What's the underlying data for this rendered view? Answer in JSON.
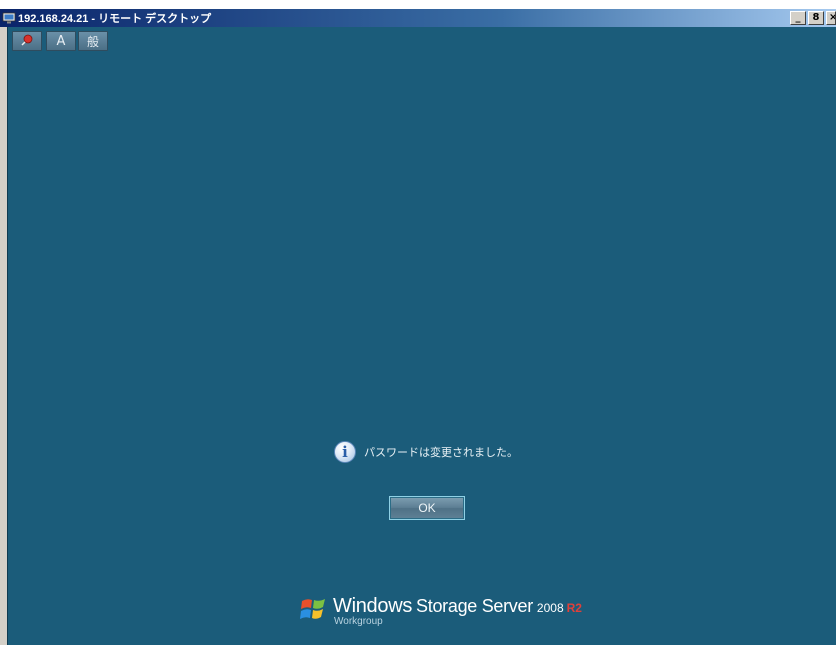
{
  "window": {
    "title": "192.168.24.21 - リモート デスクトップ",
    "controls": {
      "minimize": "_",
      "restore": "8",
      "close": "×"
    }
  },
  "toolbar": {
    "buttons": [
      {
        "icon": "pin-icon",
        "glyph": ""
      },
      {
        "icon": "input-mode-icon",
        "glyph": "A"
      },
      {
        "icon": "ime-mode-icon",
        "glyph": "般"
      }
    ]
  },
  "dialog": {
    "icon": "info-icon",
    "info_glyph": "i",
    "message": "パスワードは変更されました。",
    "ok_label": "OK"
  },
  "branding": {
    "windows": "Windows",
    "product": "Storage Server",
    "year": "2008",
    "release": "R2",
    "edition": "Workgroup"
  },
  "colors": {
    "desktop": "#1b5c7a",
    "accent_release": "#e0403a"
  }
}
